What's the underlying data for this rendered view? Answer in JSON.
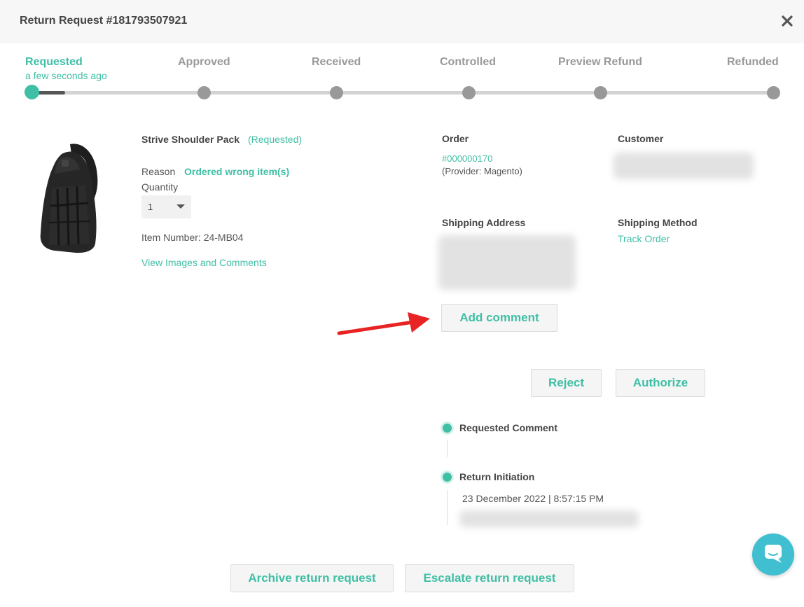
{
  "header": {
    "title": "Return Request #181793507921",
    "close_icon": "close-icon"
  },
  "progress": {
    "steps": [
      {
        "label": "Requested",
        "sub": "a few seconds ago",
        "state": "active"
      },
      {
        "label": "Approved",
        "state": "pending"
      },
      {
        "label": "Received",
        "state": "pending"
      },
      {
        "label": "Controlled",
        "state": "pending"
      },
      {
        "label": "Preview Refund",
        "state": "pending"
      },
      {
        "label": "Refunded",
        "state": "pending"
      }
    ],
    "colors": {
      "active": "#3fbfa5",
      "pending": "#999999"
    }
  },
  "item": {
    "name": "Strive Shoulder Pack",
    "status": "(Requested)",
    "reason_label": "Reason",
    "reason_value": "Ordered wrong item(s)",
    "quantity_label": "Quantity",
    "quantity_value": "1",
    "item_number": "Item Number: 24-MB04",
    "view_link": "View Images and Comments"
  },
  "order": {
    "label": "Order",
    "number": "#000000170",
    "provider": "(Provider: Magento)"
  },
  "customer": {
    "label": "Customer"
  },
  "shipping_address": {
    "label": "Shipping Address"
  },
  "shipping_method": {
    "label": "Shipping Method",
    "link": "Track Order"
  },
  "actions": {
    "add_comment": "Add comment",
    "reject": "Reject",
    "authorize": "Authorize",
    "archive": "Archive return request",
    "escalate": "Escalate return request"
  },
  "timeline": [
    {
      "title": "Requested Comment"
    },
    {
      "title": "Return Initiation",
      "date": "23 December 2022 | 8:57:15 PM"
    }
  ],
  "accent_color": "#3fbfa5"
}
